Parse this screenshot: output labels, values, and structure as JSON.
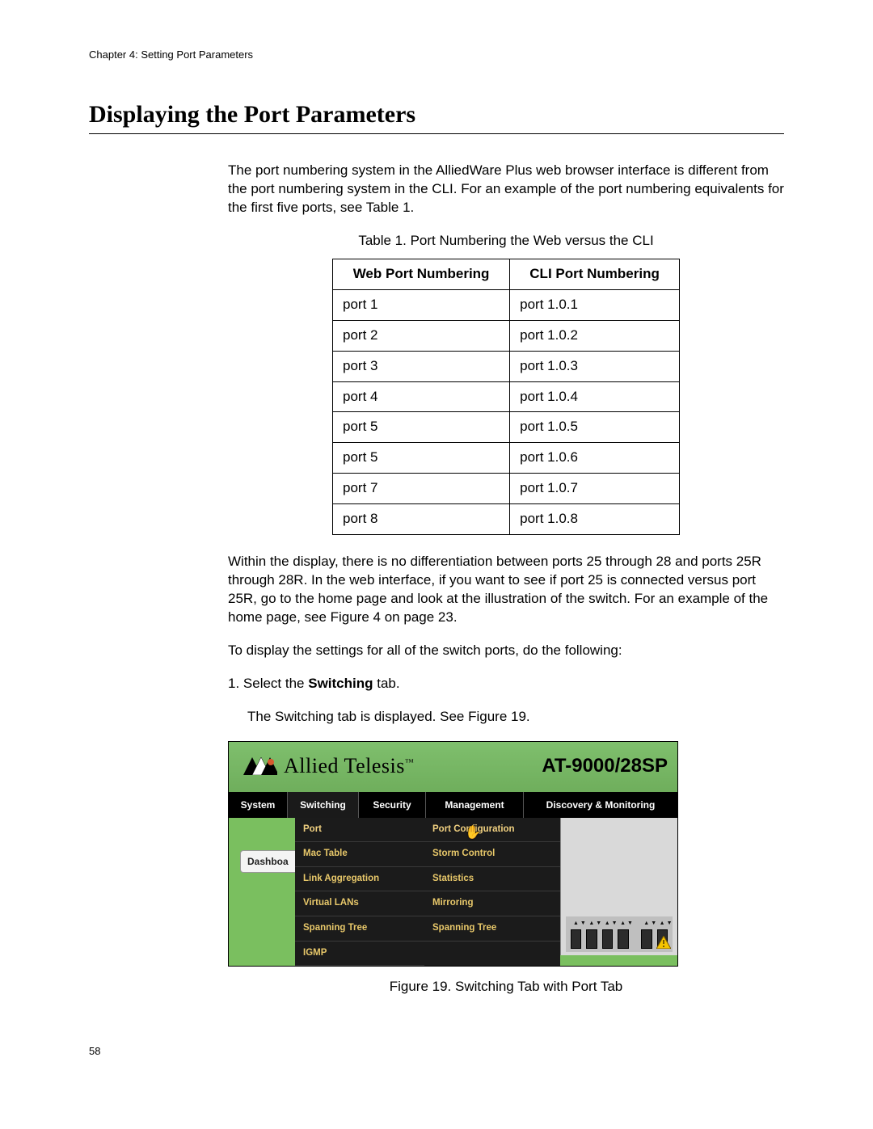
{
  "chapter_header": "Chapter 4: Setting Port Parameters",
  "section_title": "Displaying the Port Parameters",
  "intro_para": "The port numbering system in the AlliedWare Plus web browser interface is different from the port numbering system in the CLI. For an example of the port numbering equivalents for the first five ports, see Table 1.",
  "table_caption": "Table 1. Port Numbering the Web versus the CLI",
  "table_headers": {
    "web": "Web Port Numbering",
    "cli": "CLI Port Numbering"
  },
  "table_rows": [
    {
      "web": "port 1",
      "cli": "port 1.0.1"
    },
    {
      "web": "port 2",
      "cli": "port 1.0.2"
    },
    {
      "web": "port 3",
      "cli": "port 1.0.3"
    },
    {
      "web": "port 4",
      "cli": "port 1.0.4"
    },
    {
      "web": "port 5",
      "cli": "port 1.0.5"
    },
    {
      "web": "port 5",
      "cli": "port 1.0.6"
    },
    {
      "web": "port 7",
      "cli": "port 1.0.7"
    },
    {
      "web": "port 8",
      "cli": "port 1.0.8"
    }
  ],
  "para_after_table": "Within the display, there is no differentiation between ports 25 through 28 and ports 25R through 28R. In the web interface, if you want to see if port 25 is connected versus port 25R, go to the home page and look at the illustration of the switch. For an example of the home page, see Figure 4 on page 23.",
  "para_instruction": "To display the settings for all of the switch ports, do the following:",
  "step1_prefix": "1.  Select the ",
  "step1_bold": "Switching",
  "step1_suffix": " tab.",
  "step1_result": "The Switching tab is displayed. See Figure 19.",
  "figure_caption": "Figure 19. Switching Tab with Port Tab",
  "page_number": "58",
  "ui": {
    "brand_text": "Allied Telesis",
    "brand_tm": "™",
    "model": "AT-9000/28SP",
    "tabs": {
      "system": "System",
      "switching": "Switching",
      "security": "Security",
      "management": "Management",
      "discovery": "Discovery & Monitoring"
    },
    "dashboard_tab": "Dashboa",
    "menu_left": [
      "Port",
      "Mac Table",
      "Link Aggregation",
      "Virtual LANs",
      "Spanning Tree",
      "IGMP"
    ],
    "menu_right": [
      "Port Configuration",
      "Storm Control",
      "Statistics",
      "Mirroring",
      "Spanning Tree"
    ]
  }
}
